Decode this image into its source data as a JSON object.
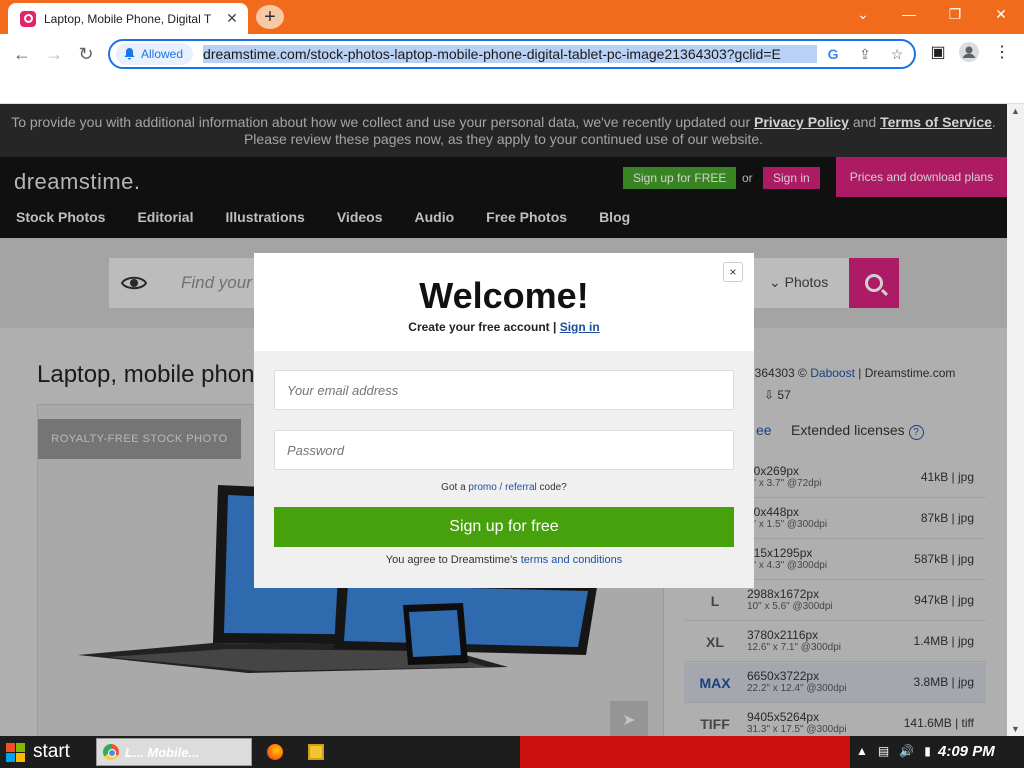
{
  "browser": {
    "tab_title": "Laptop, Mobile Phone, Digital T",
    "tab_close": "✕",
    "new_tab": "+",
    "window": {
      "minimize": "⌄",
      "min2": "—",
      "restore": "❐",
      "close": "✕"
    },
    "nav": {
      "back": "←",
      "forward": "→",
      "reload": "↻"
    },
    "site_chip": "Allowed",
    "url": "dreamstime.com/stock-photos-laptop-mobile-phone-digital-tablet-pc-image21364303?gclid=E",
    "icons": [
      "google-lens-icon",
      "share-icon",
      "star-icon",
      "sidebar-icon",
      "profile-icon",
      "kebab-menu-icon"
    ]
  },
  "notice": {
    "line1_pre": "To provide you with additional information about how we collect and use your personal data, we've recently updated our ",
    "privacy": "Privacy Policy",
    "and": " and ",
    "terms": "Terms of Service",
    "line1_end": ".",
    "line2": "Please review these pages now, as they apply to your continued use of our website."
  },
  "header": {
    "logo": "dreamstime.",
    "signup": "Sign up for FREE",
    "or": "or",
    "signin": "Sign in",
    "prices": "Prices and download plans",
    "menu": [
      "Stock Photos",
      "Editorial",
      "Illustrations",
      "Videos",
      "Audio",
      "Free Photos",
      "Blog"
    ]
  },
  "search": {
    "placeholder": "Find your",
    "category": "Photos"
  },
  "content": {
    "title": "Laptop, mobile phon",
    "badge": "ROYALTY-FREE STOCK PHOTO",
    "credit_id": "1364303 © ",
    "credit_author": "Daboost",
    "credit_site": " | Dreamstime.com",
    "downloads": "57",
    "license_tab": "ee",
    "extended": "Extended licenses",
    "sizes": [
      {
        "label": "",
        "px": "80x269px",
        "in": "7\" x 3.7\" @72dpi",
        "size": "41kB | jpg"
      },
      {
        "label": "",
        "px": "00x448px",
        "in": "7\" x 1.5\" @300dpi",
        "size": "87kB | jpg"
      },
      {
        "label": "",
        "px": "315x1295px",
        "in": "7\" x 4.3\" @300dpi",
        "size": "587kB | jpg"
      },
      {
        "label": "L",
        "px": "2988x1672px",
        "in": "10\" x 5.6\" @300dpi",
        "size": "947kB | jpg"
      },
      {
        "label": "XL",
        "px": "3780x2116px",
        "in": "12.6\" x 7.1\" @300dpi",
        "size": "1.4MB | jpg"
      },
      {
        "label": "MAX",
        "px": "6650x3722px",
        "in": "22.2\" x 12.4\" @300dpi",
        "size": "3.8MB | jpg"
      },
      {
        "label": "TIFF",
        "px": "9405x5264px",
        "in": "31.3\" x 17.5\" @300dpi",
        "size": "141.6MB | tiff"
      }
    ]
  },
  "modal": {
    "close": "×",
    "title": "Welcome!",
    "subtitle": "Create your free account",
    "sep": " | ",
    "signin": "Sign in",
    "email_placeholder": "Your email address",
    "password_placeholder": "Password",
    "promo_pre": "Got a ",
    "promo_link": "promo / referral",
    "promo_post": " code?",
    "signup_btn": "Sign up for free",
    "agree_pre": "You agree to Dreamstime's ",
    "agree_link": "terms and conditions"
  },
  "taskbar": {
    "start": "start",
    "item": "L... Mobile...",
    "clock": "4:09 PM"
  },
  "colors": {
    "accent_pink": "#d3217a",
    "accent_green": "#46a12a",
    "chrome_orange": "#f26a1b"
  }
}
